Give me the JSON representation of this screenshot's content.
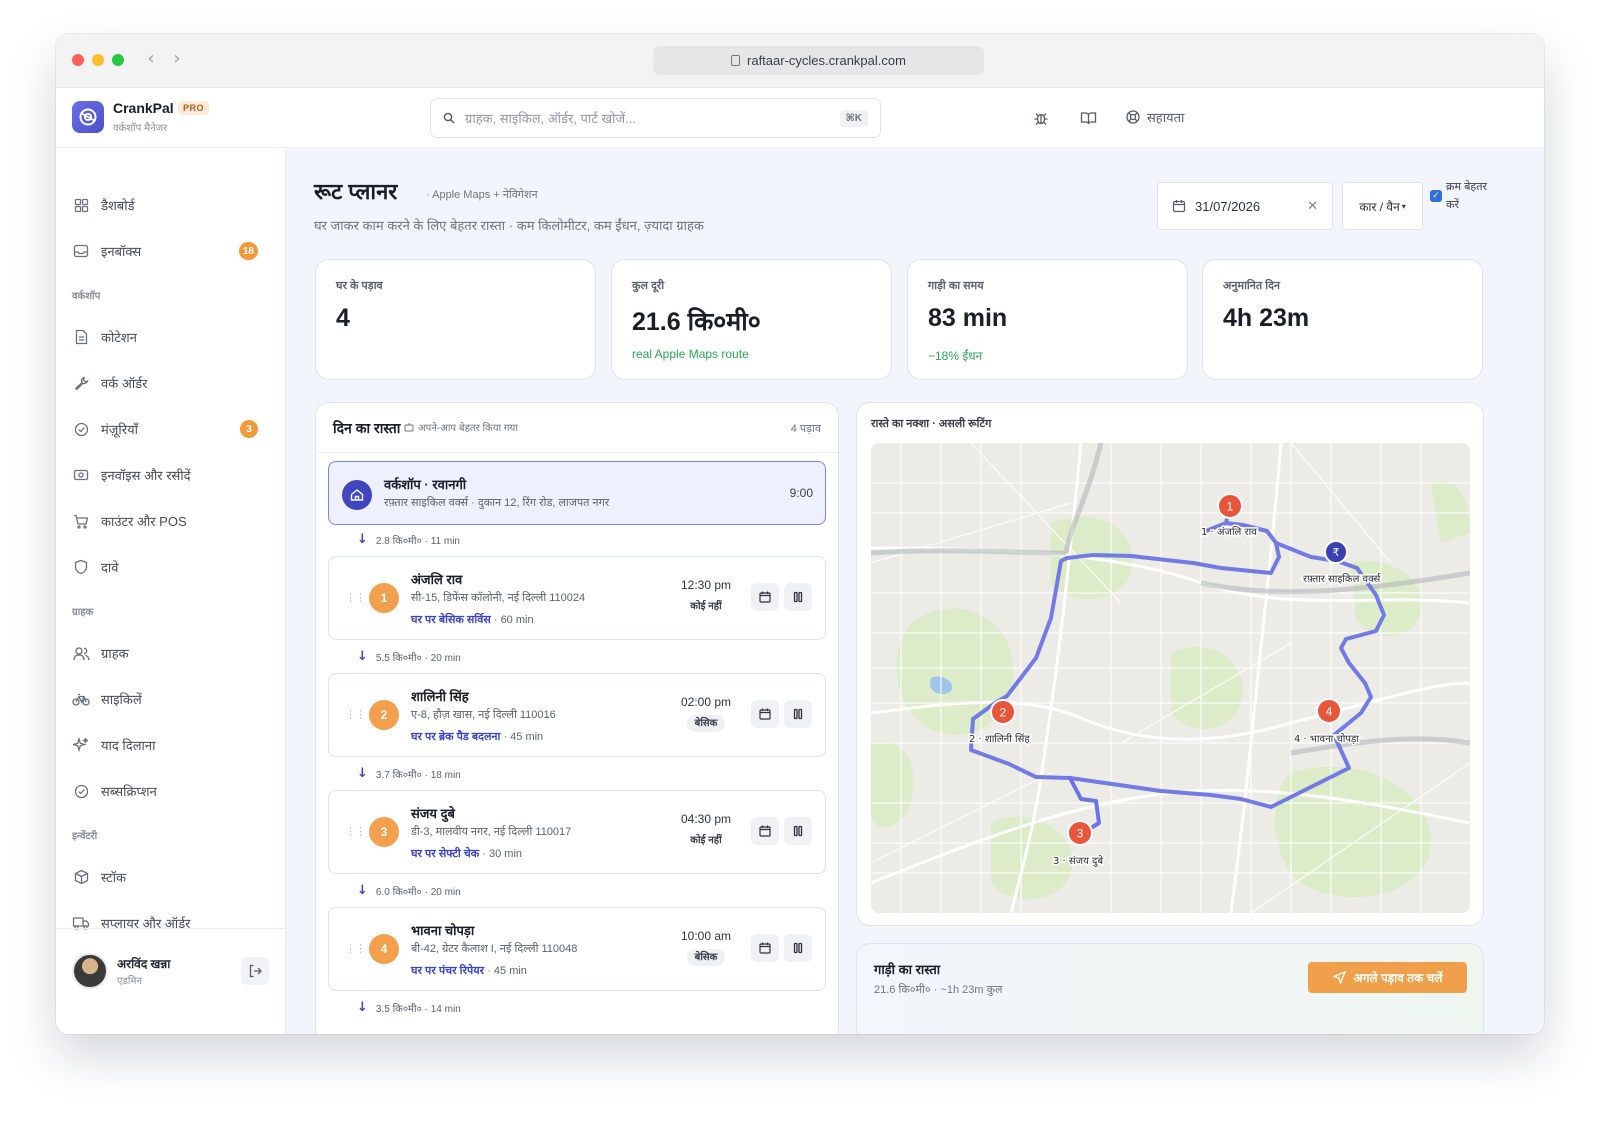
{
  "browser": {
    "url": "raftaar-cycles.crankpal.com"
  },
  "brand": {
    "name": "CrankPal",
    "badge": "PRO",
    "subtitle": "वर्कशॉप मैनेजर",
    "accent": "#4b4fc9"
  },
  "search": {
    "placeholder": "ग्राहक, साइकिल, ऑर्डर, पार्ट खोजें...",
    "shortcut": "⌘K"
  },
  "topbar": {
    "help_label": "सहायता"
  },
  "sidebar": {
    "items": [
      {
        "label": "डैशबोर्ड",
        "icon": "grid-icon"
      },
      {
        "label": "इनबॉक्स",
        "icon": "inbox-icon",
        "badge": "18"
      },
      {
        "label": "कोटेशन",
        "icon": "document-icon"
      },
      {
        "label": "वर्क ऑर्डर",
        "icon": "wrench-icon"
      },
      {
        "label": "मंज़ूरियाँ",
        "icon": "check-circle-icon",
        "badge": "3"
      },
      {
        "label": "इनवॉइस और रसीदें",
        "icon": "cash-icon"
      },
      {
        "label": "काउंटर और POS",
        "icon": "cart-icon"
      },
      {
        "label": "दावे",
        "icon": "shield-icon"
      },
      {
        "label": "ग्राहक",
        "icon": "users-icon"
      },
      {
        "label": "साइकिलें",
        "icon": "bicycle-icon"
      },
      {
        "label": "याद दिलाना",
        "icon": "sparkle-icon"
      },
      {
        "label": "सब्सक्रिप्शन",
        "icon": "check-circle-icon"
      },
      {
        "label": "स्टॉक",
        "icon": "box-icon"
      },
      {
        "label": "सप्लायर और ऑर्डर",
        "icon": "truck-icon"
      }
    ],
    "sections": [
      "वर्कशॉप",
      "ग्राहक",
      "इन्वेंटरी"
    ]
  },
  "user": {
    "name": "अरविंद खन्ना",
    "role": "एडमिन"
  },
  "page": {
    "title": "रूट प्लानर",
    "title_sub": "· Apple Maps + नेविगेशन",
    "description": "घर जाकर काम करने के लिए बेहतर रास्ता · कम किलोमीटर, कम ईंधन, ज़्यादा ग्राहक",
    "date": "31/07/2026",
    "vehicle": "कार / वैन",
    "optimize_label": "क्रम बेहतर करें",
    "optimize_checked": true
  },
  "stats": [
    {
      "label": "घर के पड़ाव",
      "value": "4",
      "note": ""
    },
    {
      "label": "कुल दूरी",
      "value": "21.6 कि०मी०",
      "note": "real Apple Maps route"
    },
    {
      "label": "गाड़ी का समय",
      "value": "83 min",
      "note": "−18% ईंधन"
    },
    {
      "label": "अनुमानित दिन",
      "value": "4h 23m",
      "note": ""
    }
  ],
  "route": {
    "title": "दिन का रास्ता",
    "tag": "अपने-आप बेहतर किया गया",
    "count": "4 पड़ाव",
    "depot": {
      "title": "वर्कशॉप · रवानगी",
      "address": "रफ़्तार साइकिल वर्क्स · दुकान 12, रिंग रोड, लाजपत नगर",
      "time": "9:00"
    },
    "legs": [
      "2.8 कि०मी० · 11 min",
      "5.5 कि०मी० · 20 min",
      "3.7 कि०मी० · 18 min",
      "6.0 कि०मी० · 20 min",
      "3.5 कि०मी० · 14 min"
    ],
    "stops": [
      {
        "num": "1",
        "name": "अंजलि राव",
        "address": "सी-15, डिफेंस कॉलोनी, नई दिल्ली 110024",
        "service": "घर पर बेसिक सर्विस",
        "duration": "· 60 min",
        "time": "12:30 pm",
        "flag": "कोई नहीं"
      },
      {
        "num": "2",
        "name": "शालिनी सिंह",
        "address": "ए-8, हौज़ खास, नई दिल्ली 110016",
        "service": "घर पर ब्रेक पैड बदलना",
        "duration": "· 45 min",
        "time": "02:00 pm",
        "flag": "बेसिक"
      },
      {
        "num": "3",
        "name": "संजय दुबे",
        "address": "डी-3, मालवीय नगर, नई दिल्ली 110017",
        "service": "घर पर सेफ्टी चेक",
        "duration": "· 30 min",
        "time": "04:30 pm",
        "flag": "कोई नहीं"
      },
      {
        "num": "4",
        "name": "भावना चोपड़ा",
        "address": "बी-42, ग्रेटर कैलाश I, नई दिल्ली 110048",
        "service": "घर पर पंचर रिपेयर",
        "duration": "· 45 min",
        "time": "10:00 am",
        "flag": "बेसिक"
      }
    ]
  },
  "map": {
    "title": "रास्ते का नक्शा · असली रूटिंग",
    "route_color": "#6b74e6",
    "pin_color": "#e8553a",
    "depot_symbol": "₹",
    "labels": [
      "1 · अंजलि राव",
      "2 · शालिनी सिंह",
      "3 · संजय दुबे",
      "4 · भावना चोपड़ा",
      "रफ़्तार साइकिल वर्क्स"
    ]
  },
  "drive": {
    "title": "गाड़ी का रास्ता",
    "sub": "21.6 कि०मी० · ~1h 23m कुल",
    "button": "अगले पड़ाव तक चलें"
  }
}
